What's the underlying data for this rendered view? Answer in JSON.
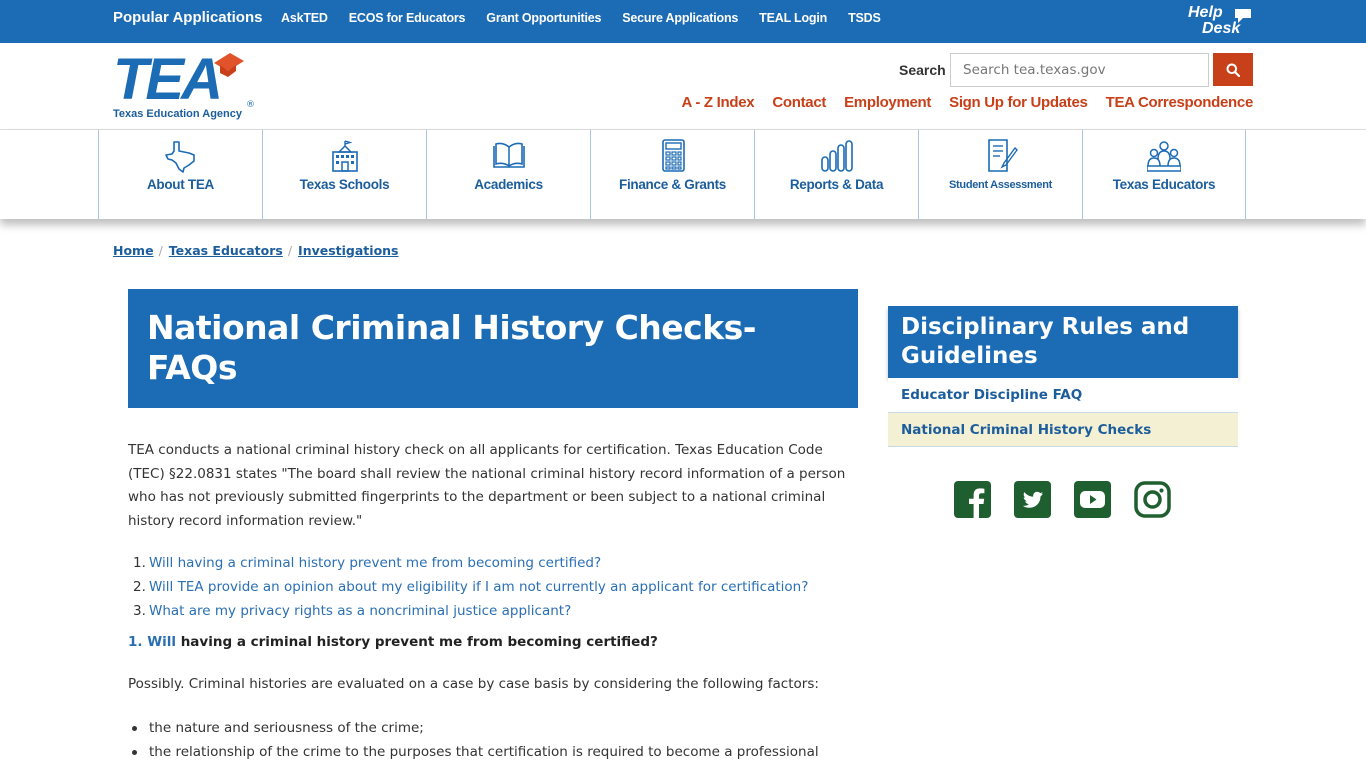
{
  "topbar": {
    "title": "Popular Applications",
    "links": [
      "AskTED",
      "ECOS for Educators",
      "Grant Opportunities",
      "Secure Applications",
      "TEAL Login",
      "TSDS"
    ],
    "helpdesk_line1": "Help",
    "helpdesk_line2": "Desk"
  },
  "logo": {
    "letters": "TEA",
    "subtitle": "Texas Education Agency",
    "registered": "®"
  },
  "search": {
    "label": "Search",
    "placeholder": "Search tea.texas.gov",
    "button_icon": "search-icon"
  },
  "util_links": [
    "A - Z Index",
    "Contact",
    "Employment",
    "Sign Up for Updates",
    "TEA Correspondence"
  ],
  "nav": [
    {
      "label": "About TEA",
      "icon": "texas-map-icon"
    },
    {
      "label": "Texas Schools",
      "icon": "school-building-icon"
    },
    {
      "label": "Academics",
      "icon": "open-book-icon"
    },
    {
      "label": "Finance & Grants",
      "icon": "calculator-icon"
    },
    {
      "label": "Reports & Data",
      "icon": "bar-chart-icon"
    },
    {
      "label": "Student Assessment",
      "icon": "test-paper-icon"
    },
    {
      "label": "Texas Educators",
      "icon": "educators-group-icon"
    }
  ],
  "breadcrumb": [
    "Home",
    "Texas Educators",
    "Investigations"
  ],
  "breadcrumb_sep": "/",
  "title": "National Criminal History Checks-FAQs",
  "intro": "TEA conducts a national criminal history check on all applicants for certification. Texas Education Code (TEC) §22.0831 states \"The board shall review the national criminal history record information of a person who has not previously submitted fingerprints to the department or been subject to a national criminal history record information review.\"",
  "faq": [
    {
      "num": "1.",
      "text": "Will having a criminal history prevent me from becoming certified?"
    },
    {
      "num": "2.",
      "text": "Will TEA provide an opinion about my eligibility if I am not currently an applicant for certification?"
    },
    {
      "num": "3.",
      "text": "What are my privacy rights as a noncriminal justice applicant?"
    }
  ],
  "question1": {
    "lead": "1. Will",
    "rest": " having a criminal history prevent me from becoming certified?"
  },
  "answer1": "Possibly. Criminal histories are evaluated on a case by case basis by considering the following factors:",
  "factors": [
    "the nature and seriousness of the crime;",
    "the relationship of the crime to the purposes that certification is required to become a professional"
  ],
  "sidebar": {
    "heading_line1": "Disciplinary Rules and",
    "heading_line2": "Guidelines",
    "links": [
      "Educator Discipline FAQ",
      "National Criminal History Checks"
    ]
  },
  "social": [
    "facebook-icon",
    "twitter-icon",
    "youtube-icon",
    "instagram-icon"
  ],
  "colors": {
    "brand_blue": "#1c6bb5",
    "accent_orange": "#c8401a",
    "social_green": "#1f5e2e",
    "active_bg": "#f4f0d4"
  }
}
